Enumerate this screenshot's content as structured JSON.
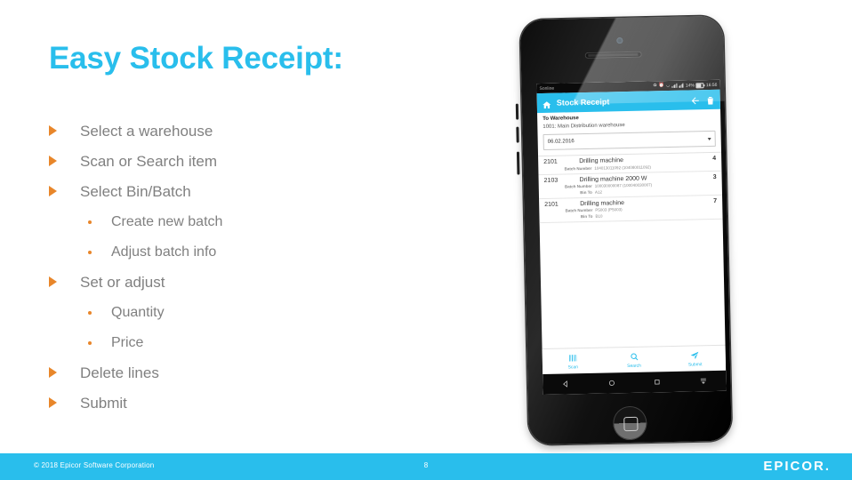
{
  "slide": {
    "title": "Easy Stock Receipt:",
    "title_color": "#29BEEC",
    "bullet_color": "#E8862A",
    "text_color": "#808080",
    "bullets": [
      {
        "level": 1,
        "text": "Select a warehouse"
      },
      {
        "level": 1,
        "text": "Scan or Search item"
      },
      {
        "level": 1,
        "text": "Select Bin/Batch"
      },
      {
        "level": 2,
        "text": "Create new batch"
      },
      {
        "level": 2,
        "text": "Adjust batch info"
      },
      {
        "level": 1,
        "text": "Set or adjust"
      },
      {
        "level": 2,
        "text": "Quantity"
      },
      {
        "level": 2,
        "text": "Price"
      },
      {
        "level": 1,
        "text": "Delete lines"
      },
      {
        "level": 1,
        "text": "Submit"
      }
    ]
  },
  "footer": {
    "copyright": "© 2018 Epicor Software Corporation",
    "page_number": "8",
    "logo": "EPICOR.",
    "background": "#29BEEC"
  },
  "phone": {
    "status_bar": {
      "carrier": "Sonline",
      "time": "16:56",
      "battery": "14%"
    },
    "app": {
      "title": "Stock Receipt",
      "header_color": "#29BEEC",
      "back_label": "Back",
      "delete_label": "Delete",
      "home_label": "Home",
      "form": {
        "warehouse_label": "To Warehouse",
        "warehouse_value": "1001: Main Distribution warehouse",
        "date_value": "06.02.2016"
      },
      "lines": [
        {
          "code": "2101",
          "description": "Drilling machine",
          "qty": "4",
          "details": [
            {
              "label": "Batch Number",
              "value": "104013011092 (104080011092)"
            }
          ]
        },
        {
          "code": "2103",
          "description": "Drilling machine 2000 W",
          "qty": "3",
          "details": [
            {
              "label": "Batch Number",
              "value": "100030000087 (100040030007)"
            },
            {
              "label": "Bin To",
              "value": "A12"
            }
          ]
        },
        {
          "code": "2101",
          "description": "Drilling machine",
          "qty": "7",
          "details": [
            {
              "label": "Batch Number",
              "value": "P5003 (P5003)"
            },
            {
              "label": "Bin To",
              "value": "B10"
            }
          ]
        }
      ],
      "tabs": [
        {
          "label": "Scan",
          "icon": "barcode-icon"
        },
        {
          "label": "Search",
          "icon": "search-icon"
        },
        {
          "label": "Submit",
          "icon": "send-icon"
        }
      ]
    }
  }
}
